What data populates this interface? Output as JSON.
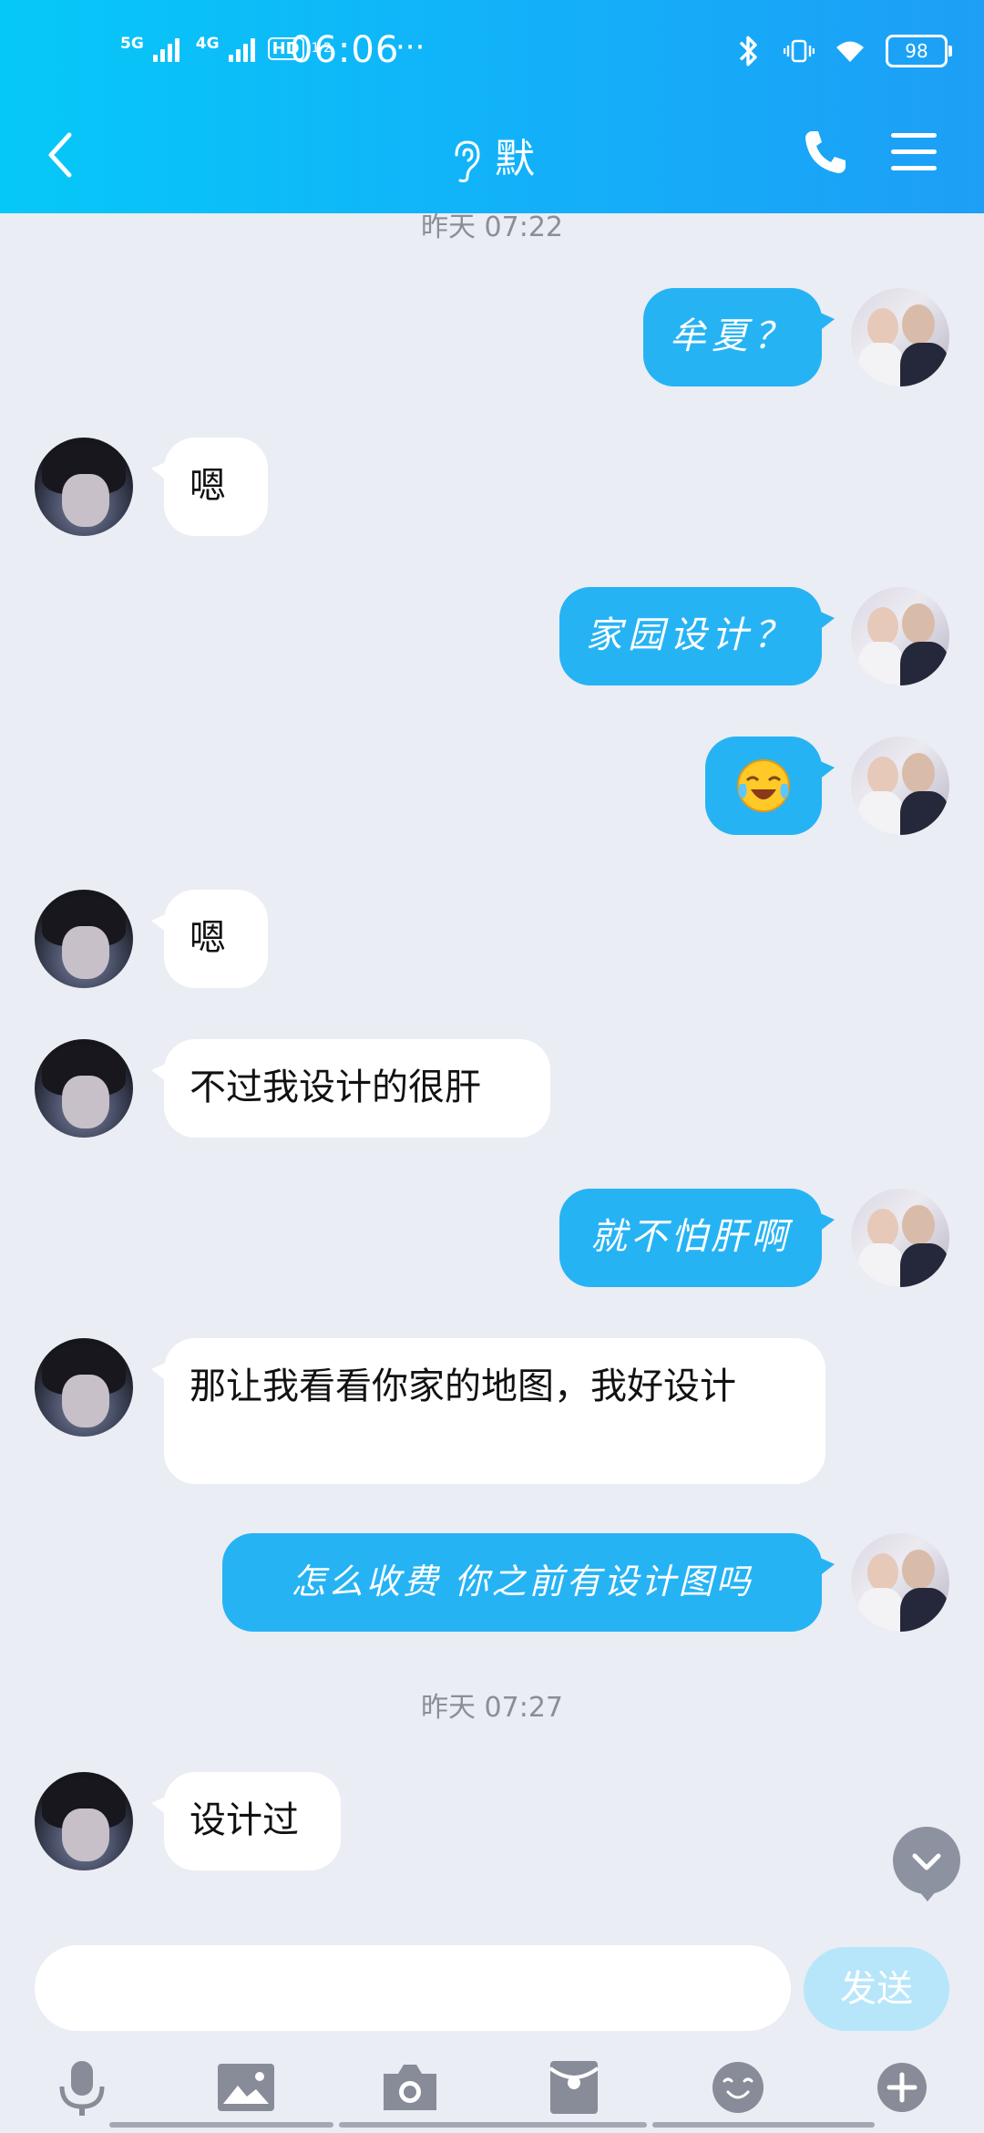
{
  "status_bar": {
    "network1": "5G",
    "network2": "4G",
    "hd": "HD",
    "hd_sub": "1 2",
    "time": "06:06",
    "more": "···",
    "battery": "98"
  },
  "header": {
    "title": "默"
  },
  "messages": [
    {
      "type": "timestamp",
      "text": "昨天 07:22"
    },
    {
      "side": "out",
      "text": "牟夏？"
    },
    {
      "side": "in",
      "text": "嗯"
    },
    {
      "side": "out",
      "text": "家园设计？"
    },
    {
      "side": "out",
      "text": "",
      "emoji": "crying-laughing-emoji"
    },
    {
      "side": "in",
      "text": "嗯"
    },
    {
      "side": "in",
      "text": "不过我设计的很肝"
    },
    {
      "side": "out",
      "text": "就不怕肝啊"
    },
    {
      "side": "in",
      "text": "那让我看看你家的地图，我好设计"
    },
    {
      "side": "out",
      "text": "怎么收费 你之前有设计图吗"
    },
    {
      "type": "timestamp",
      "text": "昨天 07:27"
    },
    {
      "side": "in",
      "text": "设计过"
    }
  ],
  "input": {
    "placeholder": "",
    "send_label": "发送"
  },
  "toolbar": [
    "voice-icon",
    "image-icon",
    "camera-icon",
    "red-packet-icon",
    "emoji-icon",
    "plus-icon"
  ],
  "colors": {
    "header_start": "#06c8f8",
    "header_end": "#1d9ff6",
    "outgoing_bubble": "#26b3f4",
    "incoming_bubble": "#ffffff",
    "chat_bg": "#eaedf4",
    "send_button": "#b7e6fb"
  }
}
